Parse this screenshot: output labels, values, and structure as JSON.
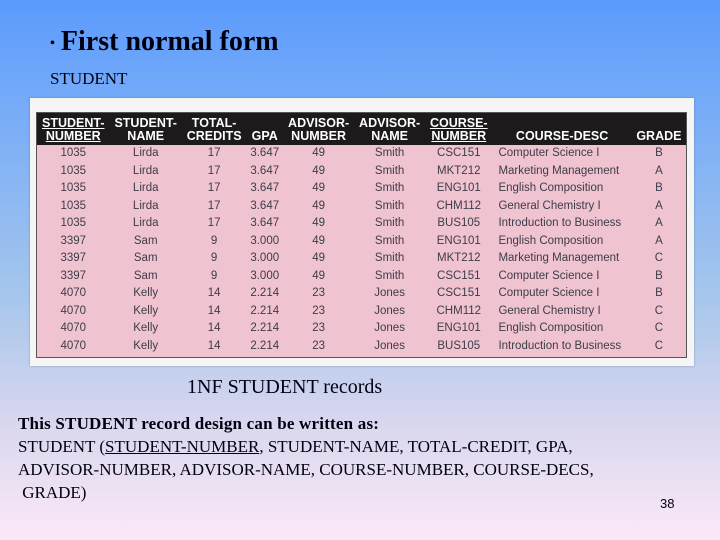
{
  "slide": {
    "bullet": "•",
    "title": "First normal form",
    "subtitle": "STUDENT",
    "caption": "1NF STUDENT records",
    "page_number": "38"
  },
  "table": {
    "columns": [
      {
        "line1": "STUDENT-",
        "line2": "NUMBER",
        "key": true
      },
      {
        "line1": "STUDENT-",
        "line2": "NAME",
        "key": false
      },
      {
        "line1": "TOTAL-",
        "line2": "CREDITS",
        "key": false
      },
      {
        "line1": "",
        "line2": "GPA",
        "key": false
      },
      {
        "line1": "ADVISOR-",
        "line2": "NUMBER",
        "key": false
      },
      {
        "line1": "ADVISOR-",
        "line2": "NAME",
        "key": false
      },
      {
        "line1": "COURSE-",
        "line2": "NUMBER",
        "key": true
      },
      {
        "line1": "",
        "line2": "COURSE-DESC",
        "key": false
      },
      {
        "line1": "",
        "line2": "GRADE",
        "key": false
      }
    ],
    "rows": [
      [
        "1035",
        "Lirda",
        "17",
        "3.647",
        "49",
        "Smith",
        "CSC151",
        "Computer Science I",
        "B"
      ],
      [
        "1035",
        "Lirda",
        "17",
        "3.647",
        "49",
        "Smith",
        "MKT212",
        "Marketing Management",
        "A"
      ],
      [
        "1035",
        "Lirda",
        "17",
        "3.647",
        "49",
        "Smith",
        "ENG101",
        "English Composition",
        "B"
      ],
      [
        "1035",
        "Lirda",
        "17",
        "3.647",
        "49",
        "Smith",
        "CHM112",
        "General Chemistry I",
        "A"
      ],
      [
        "1035",
        "Lirda",
        "17",
        "3.647",
        "49",
        "Smith",
        "BUS105",
        "Introduction to Business",
        "A"
      ],
      [
        "3397",
        "Sam",
        "9",
        "3.000",
        "49",
        "Smith",
        "ENG101",
        "English Composition",
        "A"
      ],
      [
        "3397",
        "Sam",
        "9",
        "3.000",
        "49",
        "Smith",
        "MKT212",
        "Marketing Management",
        "C"
      ],
      [
        "3397",
        "Sam",
        "9",
        "3.000",
        "49",
        "Smith",
        "CSC151",
        "Computer Science I",
        "B"
      ],
      [
        "4070",
        "Kelly",
        "14",
        "2.214",
        "23",
        "Jones",
        "CSC151",
        "Computer Science I",
        "B"
      ],
      [
        "4070",
        "Kelly",
        "14",
        "2.214",
        "23",
        "Jones",
        "CHM112",
        "General Chemistry I",
        "C"
      ],
      [
        "4070",
        "Kelly",
        "14",
        "2.214",
        "23",
        "Jones",
        "ENG101",
        "English Composition",
        "C"
      ],
      [
        "4070",
        "Kelly",
        "14",
        "2.214",
        "23",
        "Jones",
        "BUS105",
        "Introduction to Business",
        "C"
      ]
    ]
  },
  "body": {
    "intro": "This STUDENT record design can be written as:",
    "prefix": "STUDENT (",
    "primary_key": "STUDENT-NUMBER",
    "line2_rest": ", STUDENT-NAME, TOTAL-CREDIT, GPA,",
    "line3": "ADVISOR-NUMBER, ADVISOR-NAME, COURSE-NUMBER, COURSE-DECS,",
    "line4": " GRADE)"
  }
}
